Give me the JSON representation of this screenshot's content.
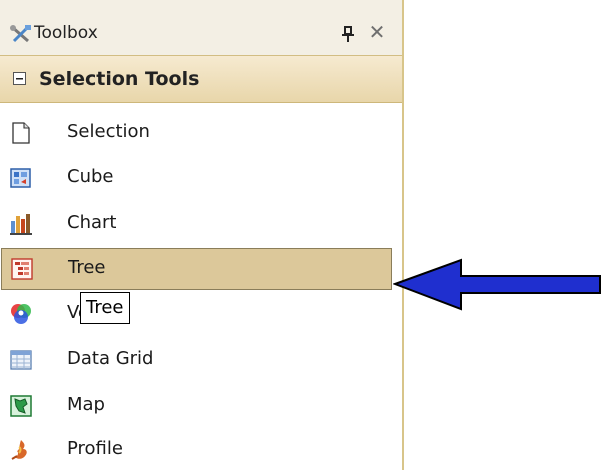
{
  "toolbox": {
    "title": "Toolbox",
    "close_glyph": "✕",
    "section": {
      "label": "Selection Tools",
      "icon": "collapse-minus-icon"
    },
    "items": [
      {
        "label": "Selection",
        "icon": "selection-page-icon"
      },
      {
        "label": "Cube",
        "icon": "cube-icon"
      },
      {
        "label": "Chart",
        "icon": "chart-icon"
      },
      {
        "label": "Tree",
        "icon": "tree-icon",
        "selected": true
      },
      {
        "label": "Venn",
        "icon": "venn-icon"
      },
      {
        "label": "Data Grid",
        "icon": "data-grid-icon"
      },
      {
        "label": "Map",
        "icon": "map-icon"
      },
      {
        "label": "Profile",
        "icon": "profile-icon"
      }
    ]
  },
  "tooltip": {
    "text": "Tree"
  },
  "colors": {
    "selected_bg": "#dcc89a",
    "section_bg": "#ecdcb4",
    "arrow": "#1f2fcf"
  }
}
